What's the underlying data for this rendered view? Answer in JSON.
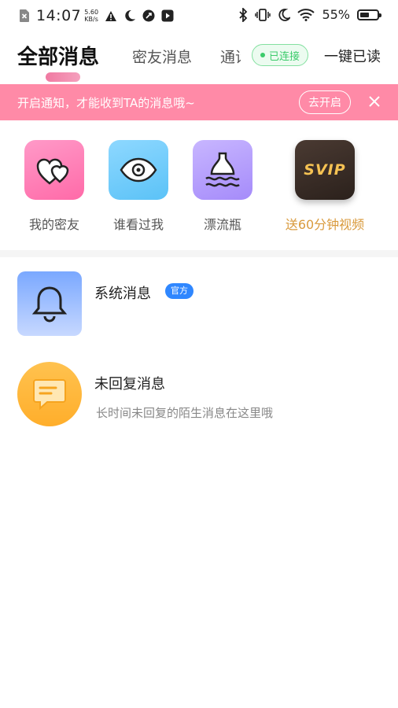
{
  "status_bar": {
    "time": "14:07",
    "speed_value": "5.60",
    "speed_unit": "KB/s",
    "battery_percent": "55%",
    "battery_level": 0.55
  },
  "tabs": {
    "all": "全部消息",
    "friend": "密友消息",
    "call": "通话",
    "connected": "已连接",
    "read_all": "一键已读"
  },
  "notice": {
    "text": "开启通知，才能收到TA的消息哦~",
    "button": "去开启"
  },
  "shortcuts": [
    {
      "label": "我的密友",
      "icon": "hearts-icon"
    },
    {
      "label": "谁看过我",
      "icon": "eye-icon"
    },
    {
      "label": "漂流瓶",
      "icon": "bottle-icon"
    },
    {
      "label": "送60分钟视频",
      "icon": "svip-icon",
      "icon_text": "SVIP"
    }
  ],
  "messages": [
    {
      "title": "系统消息",
      "badge": "官方",
      "icon": "bell-icon"
    },
    {
      "title": "未回复消息",
      "subtitle": "长时间未回复的陌生消息在这里哦",
      "icon": "chat-bubble-icon"
    }
  ],
  "colors": {
    "accent_pink": "#ff8aa7",
    "connected_green": "#3ccb6b",
    "official_blue": "#2f87ff",
    "svip_gold": "#d99a3c"
  }
}
